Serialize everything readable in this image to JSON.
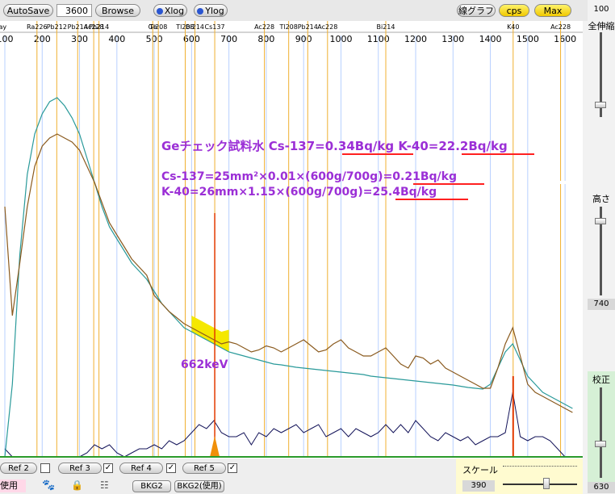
{
  "toolbar": {
    "autosave": "AutoSave",
    "seconds": "3600",
    "browse": "Browse",
    "xlog": "Xlog",
    "ylog": "Ylog",
    "line_graph": "線グラフ",
    "cps": "cps",
    "max": "Max"
  },
  "right_panel": {
    "top_value": "100",
    "zoom_label": "全伸縮",
    "height_label": "高さ",
    "height_value": "740",
    "calib_label": "校正",
    "calib_value": "630"
  },
  "bottom": {
    "ref2": "Ref 2",
    "ref3": "Ref 3",
    "ref4": "Ref 4",
    "ref5": "Ref 5",
    "use": "使用",
    "bkg2": "BKG2",
    "bkg2_use": "BKG2(使用)",
    "scale_label": "スケール",
    "scale_value": "390"
  },
  "colors": {
    "sample": "#8a5a1e",
    "reference": "#2a9a9a",
    "difference": "#14145a",
    "nuclide_line": "#f0b030",
    "cs_line": "#e33a00",
    "annotation": "#9b2fd6",
    "underline": "#ff2020",
    "highlight": "#f5e800"
  },
  "chart_data": {
    "type": "line",
    "xlim": [
      100,
      1630
    ],
    "x_ticks": [
      100,
      200,
      300,
      400,
      500,
      600,
      700,
      800,
      900,
      1000,
      1100,
      1200,
      1300,
      1400,
      1500,
      1600
    ],
    "nuclide_labels": [
      {
        "label": "Kray",
        "x": 85
      },
      {
        "label": "Ra226",
        "x": 186
      },
      {
        "label": "Pb212",
        "x": 239
      },
      {
        "label": "Pb214",
        "x": 295
      },
      {
        "label": "Ac228",
        "x": 338
      },
      {
        "label": "Pb214",
        "x": 352
      },
      {
        "label": "Ge",
        "x": 496
      },
      {
        "label": "Tl208",
        "x": 511
      },
      {
        "label": "Tl208",
        "x": 583
      },
      {
        "label": "Bi214",
        "x": 609
      },
      {
        "label": "Cs137",
        "x": 662
      },
      {
        "label": "Ac228",
        "x": 795
      },
      {
        "label": "Tl208",
        "x": 860
      },
      {
        "label": "Pb214",
        "x": 911
      },
      {
        "label": "Ac228",
        "x": 964
      },
      {
        "label": "Bi214",
        "x": 1120
      },
      {
        "label": "K40",
        "x": 1461
      },
      {
        "label": "Ac228",
        "x": 1588
      }
    ],
    "annotations": [
      "Geチェック試料水  Cs-137=0.34Bq/kg  K-40=22.2Bq/kg",
      "Cs-137=25mm²×0.01×(600g/700g)=0.21Bq/kg",
      "K-40=26mm×1.15×(600g/700g)=25.4Bq/kg",
      "662keV"
    ],
    "cs_peak_keV": 662,
    "k_peak_keV": 1461,
    "series": [
      {
        "role": "sample",
        "x": [
          100,
          120,
          140,
          160,
          180,
          200,
          220,
          240,
          260,
          280,
          300,
          320,
          340,
          360,
          380,
          400,
          420,
          440,
          460,
          480,
          500,
          520,
          540,
          560,
          580,
          600,
          620,
          640,
          660,
          680,
          700,
          720,
          740,
          760,
          780,
          800,
          820,
          840,
          860,
          880,
          900,
          920,
          940,
          960,
          980,
          1000,
          1020,
          1040,
          1060,
          1080,
          1100,
          1120,
          1140,
          1160,
          1180,
          1200,
          1220,
          1240,
          1260,
          1280,
          1300,
          1320,
          1340,
          1360,
          1380,
          1400,
          1420,
          1440,
          1460,
          1480,
          1500,
          1520,
          1540,
          1560,
          1580,
          1600,
          1620
        ],
        "y": [
          0.62,
          0.35,
          0.48,
          0.62,
          0.72,
          0.77,
          0.79,
          0.8,
          0.79,
          0.78,
          0.76,
          0.72,
          0.68,
          0.63,
          0.58,
          0.55,
          0.52,
          0.49,
          0.47,
          0.45,
          0.4,
          0.38,
          0.36,
          0.345,
          0.33,
          0.32,
          0.31,
          0.3,
          0.29,
          0.28,
          0.285,
          0.28,
          0.27,
          0.26,
          0.265,
          0.275,
          0.27,
          0.26,
          0.27,
          0.28,
          0.29,
          0.275,
          0.26,
          0.265,
          0.28,
          0.29,
          0.27,
          0.26,
          0.25,
          0.25,
          0.26,
          0.27,
          0.25,
          0.23,
          0.22,
          0.25,
          0.245,
          0.23,
          0.24,
          0.22,
          0.21,
          0.2,
          0.19,
          0.18,
          0.17,
          0.17,
          0.22,
          0.28,
          0.32,
          0.25,
          0.18,
          0.16,
          0.15,
          0.14,
          0.13,
          0.12,
          0.11
        ]
      },
      {
        "role": "reference",
        "x": [
          100,
          120,
          140,
          160,
          180,
          200,
          220,
          240,
          260,
          280,
          300,
          320,
          340,
          360,
          380,
          400,
          420,
          440,
          460,
          480,
          500,
          520,
          540,
          560,
          580,
          600,
          620,
          640,
          660,
          680,
          700,
          720,
          740,
          760,
          780,
          800,
          820,
          840,
          860,
          880,
          900,
          920,
          940,
          960,
          980,
          1000,
          1020,
          1040,
          1060,
          1080,
          1100,
          1120,
          1140,
          1160,
          1180,
          1200,
          1220,
          1240,
          1260,
          1280,
          1300,
          1320,
          1340,
          1360,
          1380,
          1400,
          1420,
          1440,
          1460,
          1480,
          1500,
          1520,
          1540,
          1560,
          1580,
          1600,
          1620
        ],
        "y": [
          0.0,
          0.18,
          0.5,
          0.7,
          0.8,
          0.85,
          0.88,
          0.89,
          0.87,
          0.84,
          0.8,
          0.74,
          0.68,
          0.62,
          0.57,
          0.54,
          0.51,
          0.48,
          0.46,
          0.44,
          0.41,
          0.38,
          0.36,
          0.34,
          0.32,
          0.31,
          0.3,
          0.29,
          0.28,
          0.27,
          0.26,
          0.255,
          0.25,
          0.245,
          0.24,
          0.235,
          0.23,
          0.228,
          0.225,
          0.222,
          0.22,
          0.218,
          0.216,
          0.214,
          0.212,
          0.21,
          0.208,
          0.206,
          0.204,
          0.2,
          0.198,
          0.196,
          0.194,
          0.192,
          0.19,
          0.188,
          0.186,
          0.184,
          0.182,
          0.18,
          0.178,
          0.175,
          0.172,
          0.17,
          0.168,
          0.18,
          0.22,
          0.26,
          0.28,
          0.24,
          0.2,
          0.18,
          0.16,
          0.15,
          0.14,
          0.13,
          0.12
        ]
      },
      {
        "role": "difference",
        "x": [
          100,
          120,
          140,
          160,
          180,
          200,
          220,
          240,
          260,
          280,
          300,
          320,
          340,
          360,
          380,
          400,
          420,
          440,
          460,
          480,
          500,
          520,
          540,
          560,
          580,
          600,
          620,
          640,
          660,
          680,
          700,
          720,
          740,
          760,
          780,
          800,
          820,
          840,
          860,
          880,
          900,
          920,
          940,
          960,
          980,
          1000,
          1020,
          1040,
          1060,
          1080,
          1100,
          1120,
          1140,
          1160,
          1180,
          1200,
          1220,
          1240,
          1260,
          1280,
          1300,
          1320,
          1340,
          1360,
          1380,
          1400,
          1420,
          1440,
          1460,
          1480,
          1500,
          1520,
          1540,
          1560,
          1580,
          1600,
          1620
        ],
        "y": [
          0.02,
          0.0,
          0.0,
          0.0,
          0.0,
          0.0,
          0.0,
          0.0,
          0.0,
          0.0,
          0.0,
          0.01,
          0.03,
          0.02,
          0.03,
          0.01,
          0.0,
          0.01,
          0.02,
          0.02,
          0.03,
          0.02,
          0.04,
          0.03,
          0.04,
          0.06,
          0.08,
          0.07,
          0.09,
          0.06,
          0.05,
          0.05,
          0.06,
          0.03,
          0.06,
          0.05,
          0.07,
          0.06,
          0.07,
          0.08,
          0.06,
          0.07,
          0.08,
          0.05,
          0.06,
          0.07,
          0.05,
          0.07,
          0.06,
          0.05,
          0.06,
          0.08,
          0.06,
          0.08,
          0.06,
          0.09,
          0.07,
          0.05,
          0.04,
          0.06,
          0.05,
          0.04,
          0.05,
          0.03,
          0.04,
          0.05,
          0.05,
          0.06,
          0.16,
          0.05,
          0.04,
          0.05,
          0.05,
          0.04,
          0.02,
          0.0,
          0.0
        ]
      }
    ]
  }
}
